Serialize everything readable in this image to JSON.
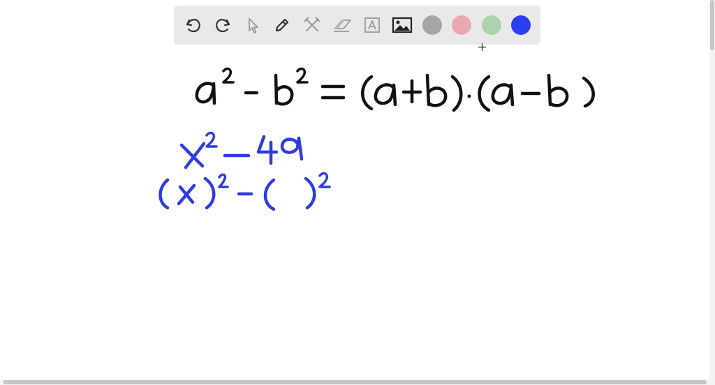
{
  "toolbar": {
    "tools": [
      {
        "name": "undo",
        "icon": "undo-icon"
      },
      {
        "name": "redo",
        "icon": "redo-icon"
      },
      {
        "name": "select",
        "icon": "pointer-icon"
      },
      {
        "name": "pen",
        "icon": "pen-icon"
      },
      {
        "name": "tools",
        "icon": "crossed-tools-icon"
      },
      {
        "name": "eraser",
        "icon": "eraser-icon"
      },
      {
        "name": "text",
        "icon": "text-box-icon",
        "glyph": "A"
      },
      {
        "name": "image",
        "icon": "image-icon"
      }
    ],
    "colors": [
      {
        "name": "gray",
        "hex": "#a6a6a6"
      },
      {
        "name": "pink",
        "hex": "#e9a9b0"
      },
      {
        "name": "green",
        "hex": "#aed2aa"
      },
      {
        "name": "blue",
        "hex": "#2b3ff2",
        "selected": true
      }
    ]
  },
  "canvas": {
    "ink_colors": {
      "black": "#111111",
      "blue": "#2f3be0"
    }
  }
}
